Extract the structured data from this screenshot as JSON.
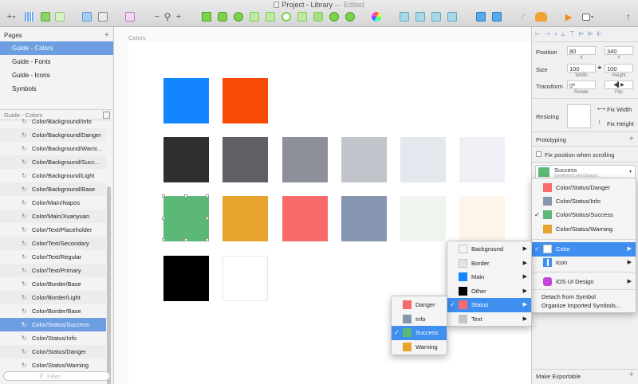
{
  "window": {
    "title": "Project - Library",
    "edited": "— Edited"
  },
  "toolbar": {
    "zoom_minus": "−",
    "zoom_plus": "+",
    "insert_plus": "+",
    "share": "↑"
  },
  "left_panel": {
    "pages_header": "Pages",
    "pages": [
      {
        "label": "Guide - Colors",
        "selected": true
      },
      {
        "label": "Guide - Fonts"
      },
      {
        "label": "Guide - Icons"
      },
      {
        "label": "Symbols"
      }
    ],
    "layers_header": "Guide - Colors",
    "layers": [
      {
        "label": "Color/Background/Info"
      },
      {
        "label": "Color/Background/Danger"
      },
      {
        "label": "Color/Background/Warni..."
      },
      {
        "label": "Color/Background/Succ..."
      },
      {
        "label": "Color/Background/Light"
      },
      {
        "label": "Color/Background/Base"
      },
      {
        "label": "Color/Main/Napos"
      },
      {
        "label": "Color/Main/Xuanyuan"
      },
      {
        "label": "Color/Text/Placeholder"
      },
      {
        "label": "Color/Text/Secondary"
      },
      {
        "label": "Color/Text/Regular"
      },
      {
        "label": "Color/Text/Primary"
      },
      {
        "label": "Color/Border/Base"
      },
      {
        "label": "Color/Border/Light"
      },
      {
        "label": "Color/Border/Base"
      },
      {
        "label": "Color/Status/Success",
        "selected": true
      },
      {
        "label": "Color/Status/Info"
      },
      {
        "label": "Color/Status/Danger"
      },
      {
        "label": "Color/Status/Warning"
      }
    ],
    "filter_placeholder": "Filter"
  },
  "canvas": {
    "artboard_label": "Colors",
    "swatches": [
      {
        "color": "#1385ff"
      },
      {
        "color": "#fa4b07"
      },
      {
        "color": "#2f2f31"
      },
      {
        "color": "#5f6063"
      },
      {
        "color": "#8d9098"
      },
      {
        "color": "#c1c4cb"
      },
      {
        "color": "#e5e7ee"
      },
      {
        "color": "#eef0f5"
      },
      {
        "color": "#5cb876",
        "selected": true
      },
      {
        "color": "#e6a42f"
      },
      {
        "color": "#f86b6b"
      },
      {
        "color": "#8695b0"
      },
      {
        "color": "#eff5ee"
      },
      {
        "color": "#fdf5ea"
      },
      {
        "color": "#000000"
      },
      {
        "color": "#ffffff"
      }
    ]
  },
  "inspector": {
    "position_label": "Position",
    "x_value": "80",
    "y_value": "340",
    "x_sub": "X",
    "y_sub": "Y",
    "size_label": "Size",
    "width_value": "100",
    "height_value": "100",
    "width_sub": "Width",
    "height_sub": "Height",
    "transform_label": "Transform",
    "rotate_value": "0º",
    "rotate_sub": "Rotate",
    "flip_sub": "Flip",
    "resizing_label": "Resizing",
    "fix_width": "Fix Width",
    "fix_height": "Fix Height",
    "prototyping_label": "Prototyping",
    "fix_position": "Fix position when scrolling",
    "override_name": "Success",
    "override_path": "Symbols/Color/Status/...",
    "make_exportable": "Make Exportable"
  },
  "symbol_menu": {
    "items": [
      {
        "label": "Color/Status/Danger",
        "color": "#f86b6b"
      },
      {
        "label": "Color/Status/Info",
        "color": "#8695b0"
      },
      {
        "label": "Color/Status/Success",
        "color": "#5cb876",
        "checked": true
      },
      {
        "label": "Color/Status/Warning",
        "color": "#e6a42f"
      },
      {
        "label": "Color",
        "color": "#ffffff",
        "checked": true,
        "highlighted": true,
        "submenu": true
      },
      {
        "label": "Icon",
        "icon": "grid-icon",
        "submenu": true
      },
      {
        "label": "iOS UI Design",
        "icon": "library-icon",
        "color": "#c145d8",
        "submenu": true
      },
      {
        "label": "Detach from Symbol"
      },
      {
        "label": "Organize Imported Symbols..."
      }
    ]
  },
  "category_menu": {
    "items": [
      {
        "label": "Background",
        "color": "#f5f5f5"
      },
      {
        "label": "Border",
        "color": "#e4e4e4"
      },
      {
        "label": "Main",
        "color": "#1385ff"
      },
      {
        "label": "Other",
        "color": "#000000"
      },
      {
        "label": "Status",
        "color": "#f86b6b",
        "checked": true,
        "highlighted": true
      },
      {
        "label": "Text",
        "color": "#c1c4cb"
      }
    ]
  },
  "status_menu": {
    "items": [
      {
        "label": "Danger",
        "color": "#f86b6b"
      },
      {
        "label": "Info",
        "color": "#8695b0"
      },
      {
        "label": "Success",
        "color": "#5cb876",
        "checked": true,
        "highlighted": true
      },
      {
        "label": "Warning",
        "color": "#e6a42f"
      }
    ]
  }
}
